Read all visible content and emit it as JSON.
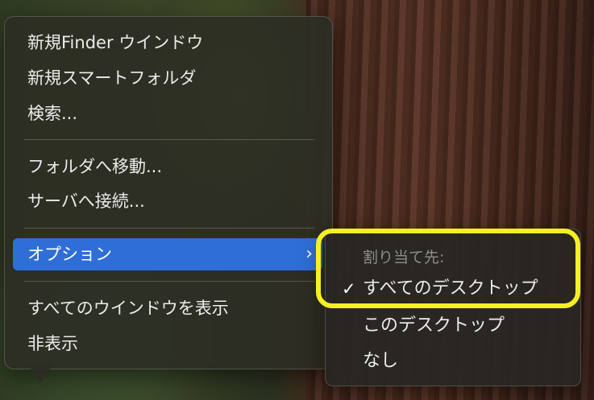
{
  "menu": {
    "items": [
      {
        "label": "新規Finder ウインドウ"
      },
      {
        "label": "新規スマートフォルダ"
      },
      {
        "label": "検索..."
      },
      {
        "label": "フォルダへ移動..."
      },
      {
        "label": "サーバへ接続..."
      },
      {
        "label": "オプション"
      },
      {
        "label": "すべてのウインドウを表示"
      },
      {
        "label": "非表示"
      }
    ],
    "selected_index": 5,
    "submenu_chevron": "chevron-right-icon"
  },
  "submenu": {
    "header": "割り当て先:",
    "items": [
      {
        "label": "すべてのデスクトップ",
        "checked": true
      },
      {
        "label": "このデスクトップ",
        "checked": false
      },
      {
        "label": "なし",
        "checked": false
      }
    ],
    "check_icon": "checkmark-icon"
  },
  "colors": {
    "selection": "#2f6ed6",
    "highlight_box": "#f5f021"
  }
}
